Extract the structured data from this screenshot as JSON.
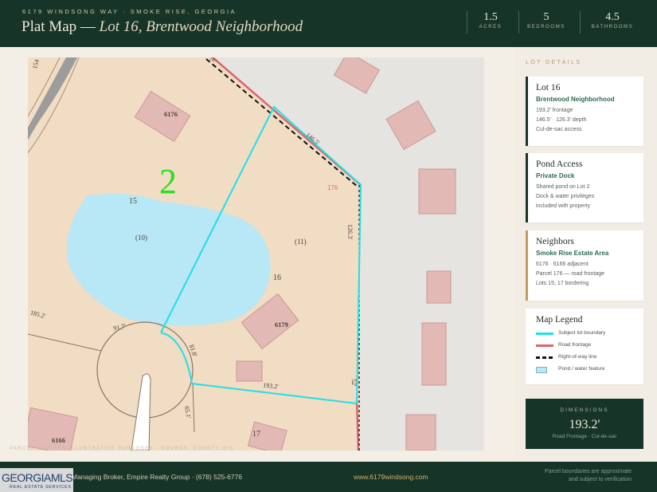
{
  "header": {
    "address": "6179 WINDSONG WAY · SMOKE RISE, GEORGIA",
    "title_main": "Plat Map — ",
    "title_italic": "Lot 16, Brentwood Neighborhood",
    "stats": [
      {
        "value": "1.5",
        "label": "ACRES"
      },
      {
        "value": "5",
        "label": "BEDROOMS"
      },
      {
        "value": "4.5",
        "label": "BATHROOMS"
      }
    ]
  },
  "map": {
    "disclaimer": "PARCEL MAP FOR ILLUSTRATIVE PURPOSES · SOURCE: COUNTY GIS",
    "labels": {
      "lot_big": "2",
      "lot_6176": "6176",
      "lot_6179": "6179",
      "lot_6166": "6166",
      "lot_15": "15",
      "lot_16": "16",
      "lot_17": "17",
      "pond_10": "(10)",
      "lot_11": "(11)",
      "parcel_176": "176",
      "corner_154": "154",
      "dim_1465": "146.5'",
      "dim_1263": "126.3'",
      "dim_1932": "193.2'",
      "dim_818": "81.8'",
      "dim_917": "91.7'",
      "dim_1852": "185.2'",
      "dim_52": "52'",
      "dim_65": "65.1'",
      "dim_18": "18'"
    }
  },
  "sidebar": {
    "section_title": "LOT DETAILS",
    "cards": [
      {
        "title": "Lot 16",
        "subtitle": "Brentwood Neighborhood",
        "lines": [
          "193.2' frontage",
          "146.5' · 126.3' depth",
          "Cul-de-sac access"
        ]
      },
      {
        "title": "Pond Access",
        "subtitle": "Private Dock",
        "lines": [
          "Shared pond on Lot 2",
          "Dock & water privileges",
          "included with property"
        ]
      },
      {
        "title": "Neighbors",
        "subtitle": "Smoke Rise Estate Area",
        "lines": [
          "6176 · 6166 adjacent",
          "Parcel 176 — road frontage",
          "Lots 15, 17 bordering"
        ]
      }
    ],
    "legend": {
      "title": "Map Legend",
      "items": [
        "Subject lot boundary",
        "Road frontage",
        "Right-of-way line",
        "Pond / water feature"
      ]
    },
    "dimensions": {
      "label": "DIMENSIONS",
      "value": "193.2'",
      "sub": "Road Frontage · Cul-de-sac"
    }
  },
  "colors": {
    "primary": "#163528",
    "accent": "#c29c5c",
    "boundary": "#1fe0e8",
    "frontage": "#d9666a",
    "pond": "#b8e7f6"
  },
  "footer": {
    "broker": "Managing Broker, Empire Realty Group · (678) 525-6776",
    "website": "www.6179windsong.com",
    "note_line1": "Parcel boundaries are approximate",
    "note_line2": "and subject to verification",
    "mls_brand": "GEORGIAMLS",
    "mls_sub": "REAL ESTATE SERVICES"
  }
}
